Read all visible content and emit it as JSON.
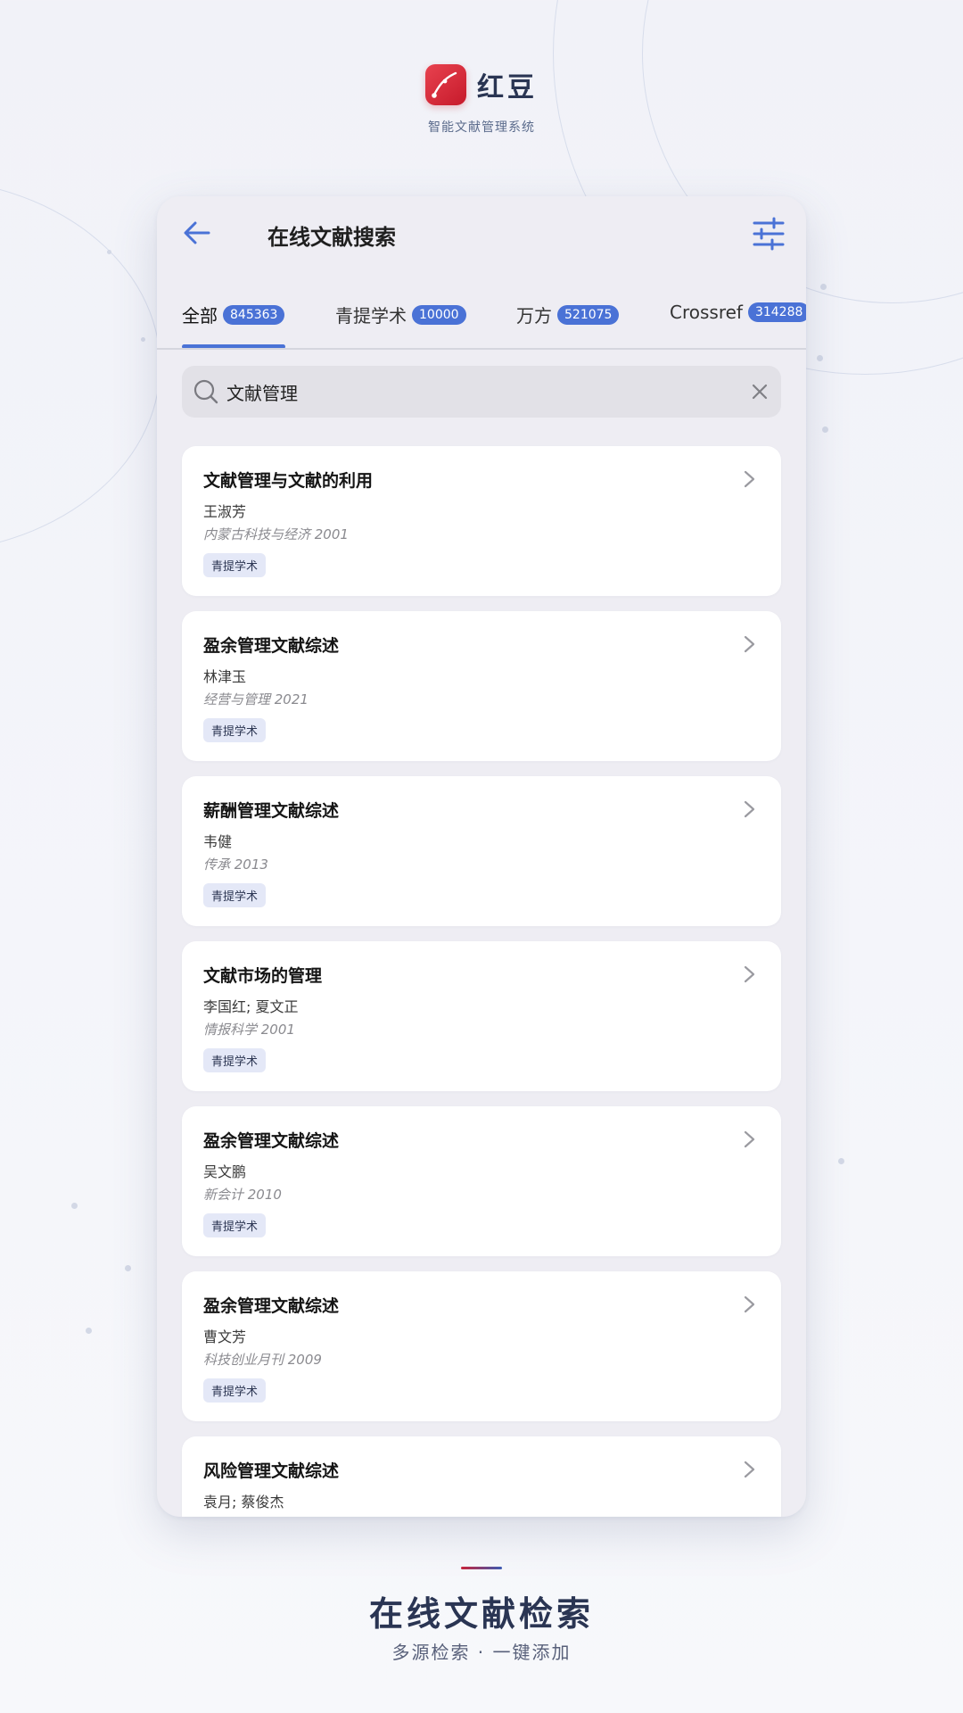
{
  "brand": {
    "name": "红豆",
    "subtitle": "智能文献管理系统",
    "logo_color": "#d42535"
  },
  "topbar": {
    "back_icon": "arrow-left",
    "title": "在线文献搜索",
    "filter_icon": "sliders"
  },
  "tabs": [
    {
      "label": "全部",
      "count": "845363",
      "active": true
    },
    {
      "label": "青提学术",
      "count": "10000",
      "active": false
    },
    {
      "label": "万方",
      "count": "521075",
      "active": false
    },
    {
      "label": "Crossref",
      "count": "314288",
      "active": false
    }
  ],
  "search": {
    "value": "文献管理",
    "search_icon": "magnifier",
    "clear_icon": "x"
  },
  "results": [
    {
      "title": "文献管理与文献的利用",
      "authors": "王淑芳",
      "source": "内蒙古科技与经济  2001",
      "tag": "青提学术"
    },
    {
      "title": "盈余管理文献综述",
      "authors": "林津玉",
      "source": "经营与管理  2021",
      "tag": "青提学术"
    },
    {
      "title": "薪酬管理文献综述",
      "authors": "韦健",
      "source": "传承  2013",
      "tag": "青提学术"
    },
    {
      "title": "文献市场的管理",
      "authors": "李国红; 夏文正",
      "source": "情报科学  2001",
      "tag": "青提学术"
    },
    {
      "title": "盈余管理文献综述",
      "authors": "吴文鹏",
      "source": "新会计  2010",
      "tag": "青提学术"
    },
    {
      "title": "盈余管理文献综述",
      "authors": "曹文芳",
      "source": "科技创业月刊  2009",
      "tag": "青提学术"
    },
    {
      "title": "风险管理文献综述",
      "authors": "袁月; 蔡俊杰",
      "source": "",
      "tag": ""
    }
  ],
  "caption": {
    "title": "在线文献检索",
    "subtitle": "多源检索 · 一键添加"
  },
  "colors": {
    "accent": "#4a72d6",
    "brand_text": "#2a3553",
    "tag_bg": "#e4e8f7"
  }
}
